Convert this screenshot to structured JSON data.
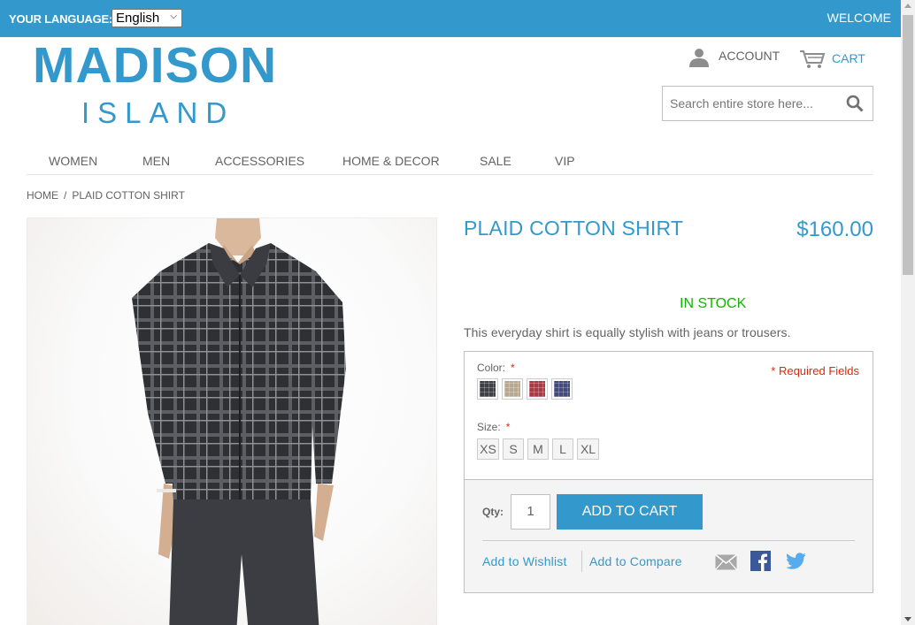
{
  "header": {
    "language_label": "YOUR LANGUAGE:",
    "language_value": "English",
    "welcome": "WELCOME",
    "logo_main": "MADISON",
    "logo_sub": "ISLAND",
    "account": "ACCOUNT",
    "cart": "CART",
    "search_placeholder": "Search entire store here..."
  },
  "nav": {
    "items": [
      "WOMEN",
      "MEN",
      "ACCESSORIES",
      "HOME & DECOR",
      "SALE",
      "VIP"
    ]
  },
  "breadcrumb": {
    "home": "HOME",
    "separator": "/",
    "current": "PLAID COTTON SHIRT"
  },
  "product": {
    "name": "PLAID COTTON SHIRT",
    "price": "$160.00",
    "stock": "IN STOCK",
    "description": "This everyday shirt is equally stylish with jeans or trousers.",
    "color_label": "Color:",
    "required_star": "*",
    "required_fields": "* Required Fields",
    "colors": [
      {
        "name": "charcoal",
        "hex": "#3d3f45"
      },
      {
        "name": "khaki",
        "hex": "#b8a892"
      },
      {
        "name": "red",
        "hex": "#a83a44"
      },
      {
        "name": "blue",
        "hex": "#414a78"
      }
    ],
    "size_label": "Size:",
    "sizes": [
      "XS",
      "S",
      "M",
      "L",
      "XL"
    ],
    "qty_label": "Qty:",
    "qty_value": "1",
    "add_to_cart": "ADD TO CART",
    "add_to_wishlist": "Add to Wishlist",
    "add_to_compare": "Add to Compare"
  },
  "colors": {
    "brand": "#3399cc",
    "in_stock": "#11b400",
    "required": "#df280a",
    "text": "#636363"
  }
}
